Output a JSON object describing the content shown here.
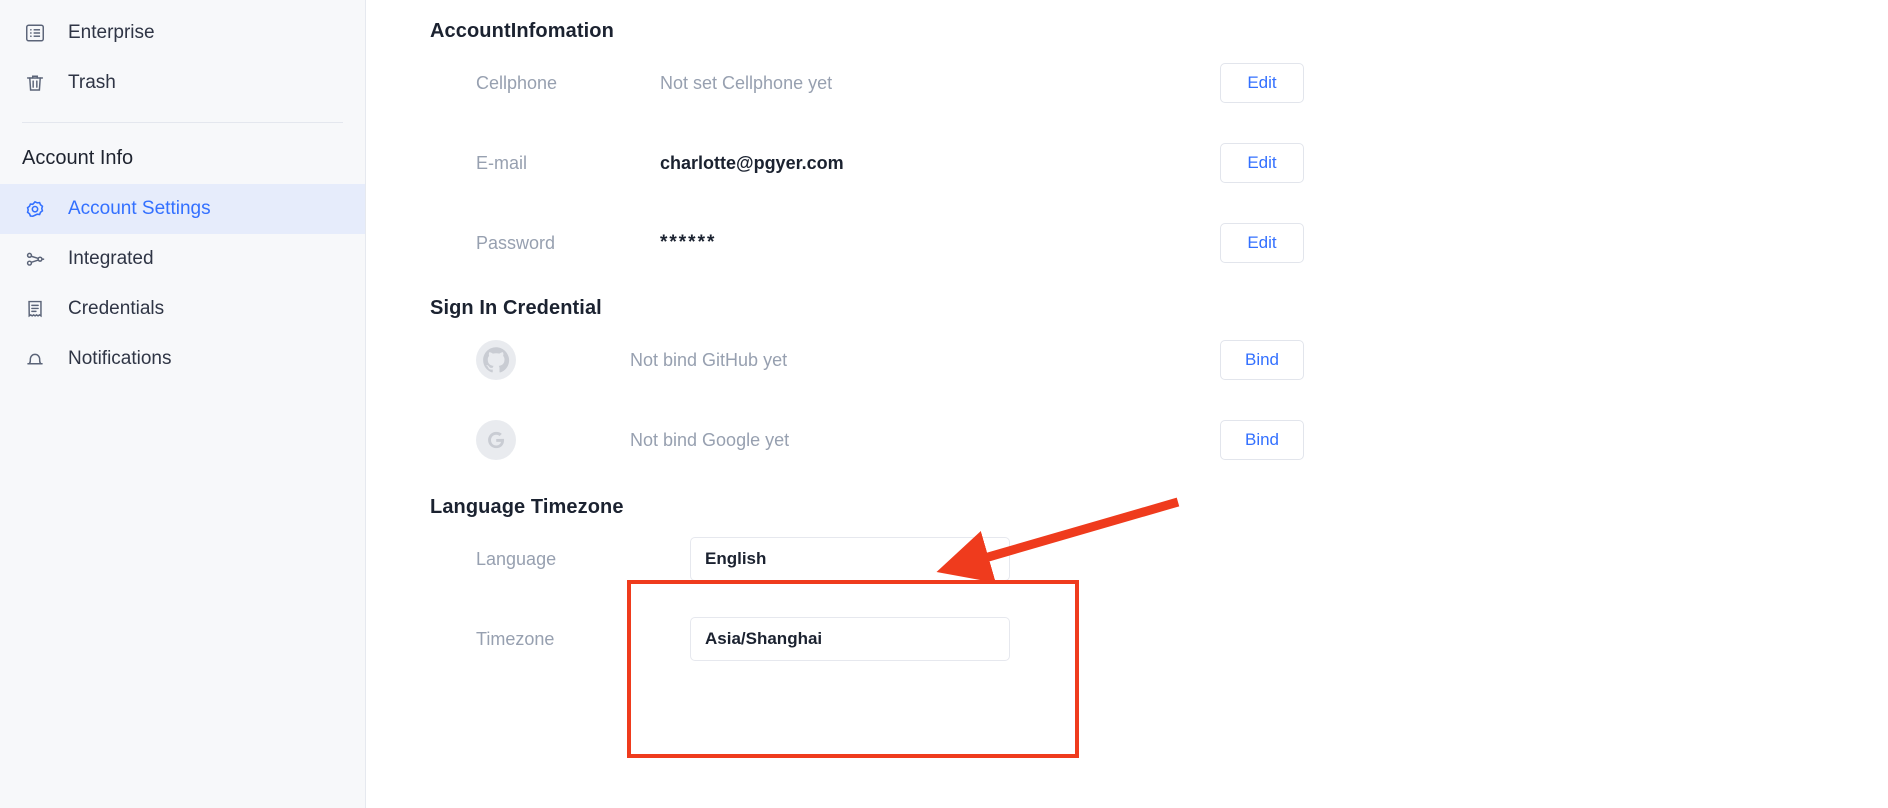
{
  "sidebar": {
    "top_items": [
      {
        "label": "Enterprise",
        "icon": "list-box-icon",
        "active": false
      },
      {
        "label": "Trash",
        "icon": "trash-icon",
        "active": false
      }
    ],
    "section_title": "Account Info",
    "items": [
      {
        "label": "Account Settings",
        "icon": "gear-icon",
        "active": true
      },
      {
        "label": "Integrated",
        "icon": "share-nodes-icon",
        "active": false
      },
      {
        "label": "Credentials",
        "icon": "document-icon",
        "active": false
      },
      {
        "label": "Notifications",
        "icon": "bell-icon",
        "active": false
      }
    ]
  },
  "main": {
    "account_info": {
      "heading": "AccountInfomation",
      "rows": [
        {
          "label": "Cellphone",
          "value": "Not set Cellphone yet",
          "value_style": "muted",
          "action": "Edit"
        },
        {
          "label": "E-mail",
          "value": "charlotte@pgyer.com",
          "value_style": "strong",
          "action": "Edit"
        },
        {
          "label": "Password",
          "value": "******",
          "value_style": "mask",
          "action": "Edit"
        }
      ]
    },
    "sign_in_credential": {
      "heading": "Sign In Credential",
      "rows": [
        {
          "icon": "github-icon",
          "value": "Not bind GitHub yet",
          "action": "Bind"
        },
        {
          "icon": "google-icon",
          "value": "Not bind Google yet",
          "action": "Bind"
        }
      ]
    },
    "language_timezone": {
      "heading": "Language Timezone",
      "rows": [
        {
          "label": "Language",
          "value": "English"
        },
        {
          "label": "Timezone",
          "value": "Asia/Shanghai"
        }
      ]
    }
  },
  "annotations": {
    "highlight_color": "#ef3b1d",
    "arrow_color": "#ef3b1d"
  },
  "colors": {
    "accent": "#3370ff",
    "sidebar_bg": "#f7f8fa",
    "active_bg": "#e6ecfb",
    "muted_text": "#97a0b0",
    "heading_text": "#1b2230"
  }
}
